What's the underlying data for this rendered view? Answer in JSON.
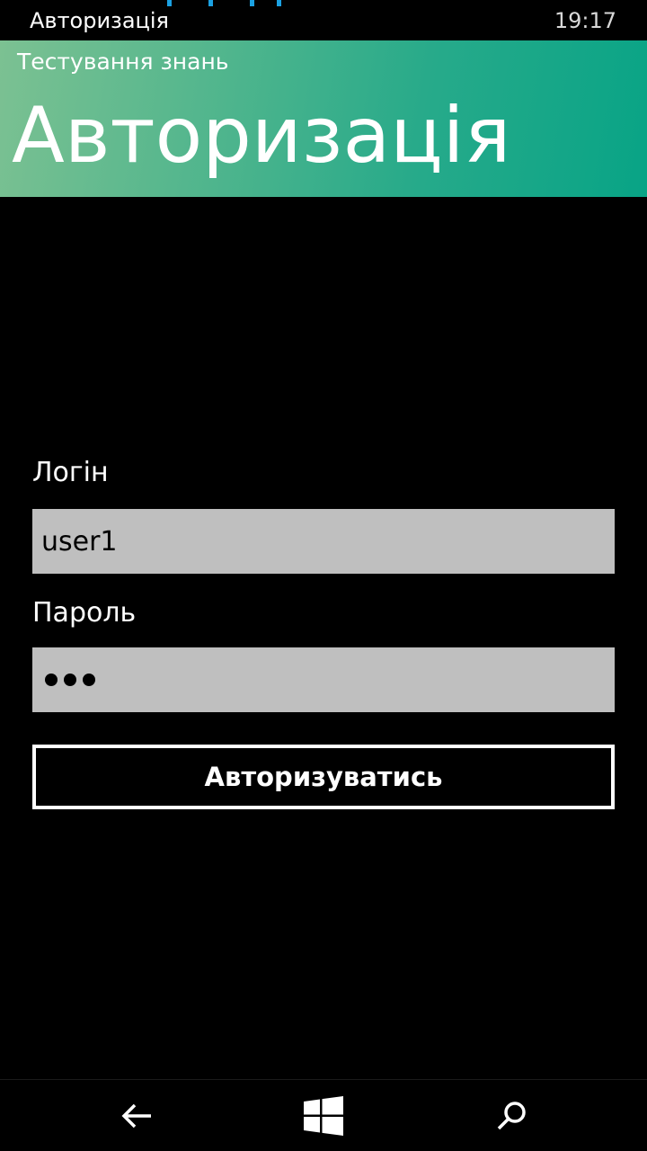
{
  "status_bar": {
    "title": "Авторизація",
    "time": "19:17"
  },
  "header": {
    "app_name": "Тестування знань",
    "page_title": "Авторизація",
    "background_start": "#7cc192",
    "background_end": "#08a486"
  },
  "form": {
    "login_label": "Логін",
    "login_value": "user1",
    "password_label": "Пароль",
    "password_masked_length": 3,
    "submit_label": "Авторизуватись"
  },
  "nav_bar": {
    "back_icon": "back-arrow-icon",
    "start_icon": "windows-logo-icon",
    "search_icon": "search-icon"
  },
  "colors": {
    "background": "#000000",
    "input_background": "#bfbfbf",
    "signal_accent": "#1ba1e2"
  }
}
